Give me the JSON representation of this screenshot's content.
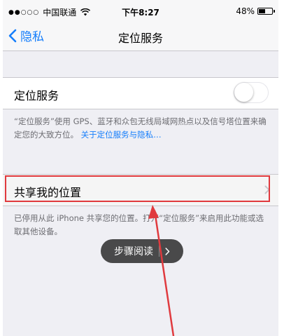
{
  "status_bar": {
    "signal": "●●○○○",
    "carrier": "中国联通",
    "time": "下午8:27",
    "battery": "48%",
    "battery_level": 0.48
  },
  "nav": {
    "back_label": "隐私",
    "title": "定位服务"
  },
  "location_services": {
    "label": "定位服务",
    "enabled": false
  },
  "footer_1": {
    "text": "“定位服务”使用 GPS、蓝牙和众包无线局域网热点以及信号塔位置来确定您的大致方位。",
    "link": "关于定位服务与隐私…"
  },
  "share_location": {
    "label": "共享我的位置"
  },
  "footer_2": {
    "text": "已停用从此 iPhone 共享您的位置。打开“定位服务”来启用此功能或选取其他设备。"
  },
  "step_reading": {
    "label": "步骤阅读"
  },
  "colors": {
    "accent": "#157efb",
    "highlight": "#e03a3e"
  }
}
